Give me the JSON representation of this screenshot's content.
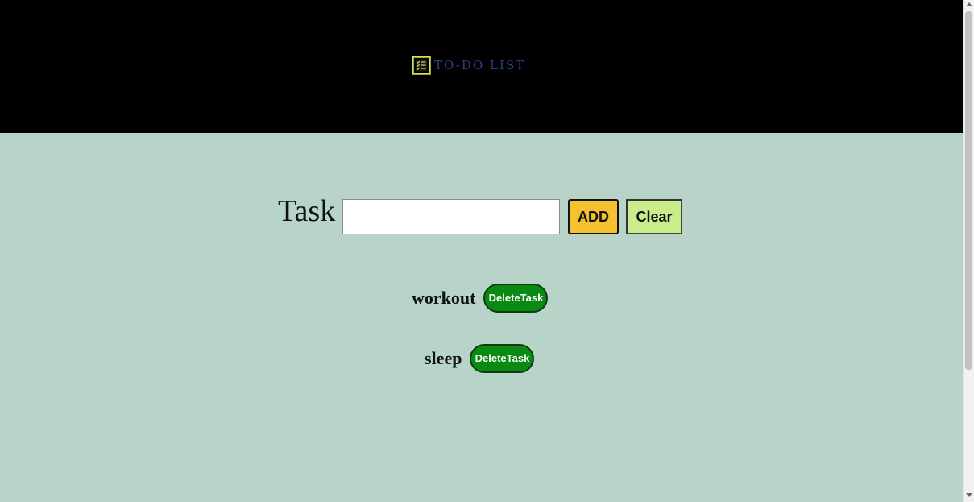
{
  "header": {
    "logo_icon": "checklist-icon",
    "title": "TO-DO LIST"
  },
  "form": {
    "label": "Task",
    "input_value": "",
    "input_placeholder": "",
    "add_label": "ADD",
    "clear_label": "Clear"
  },
  "tasks": [
    {
      "text": "workout",
      "delete_label": "DeleteTask"
    },
    {
      "text": "sleep",
      "delete_label": "DeleteTask"
    }
  ],
  "colors": {
    "header_bg": "#000000",
    "page_bg": "#b8d4c8",
    "logo_text": "#2b3f8f",
    "logo_icon": "#d8e04a",
    "add_button": "#f5c12e",
    "clear_button": "#c9ec8c",
    "delete_button": "#0a8a13"
  }
}
